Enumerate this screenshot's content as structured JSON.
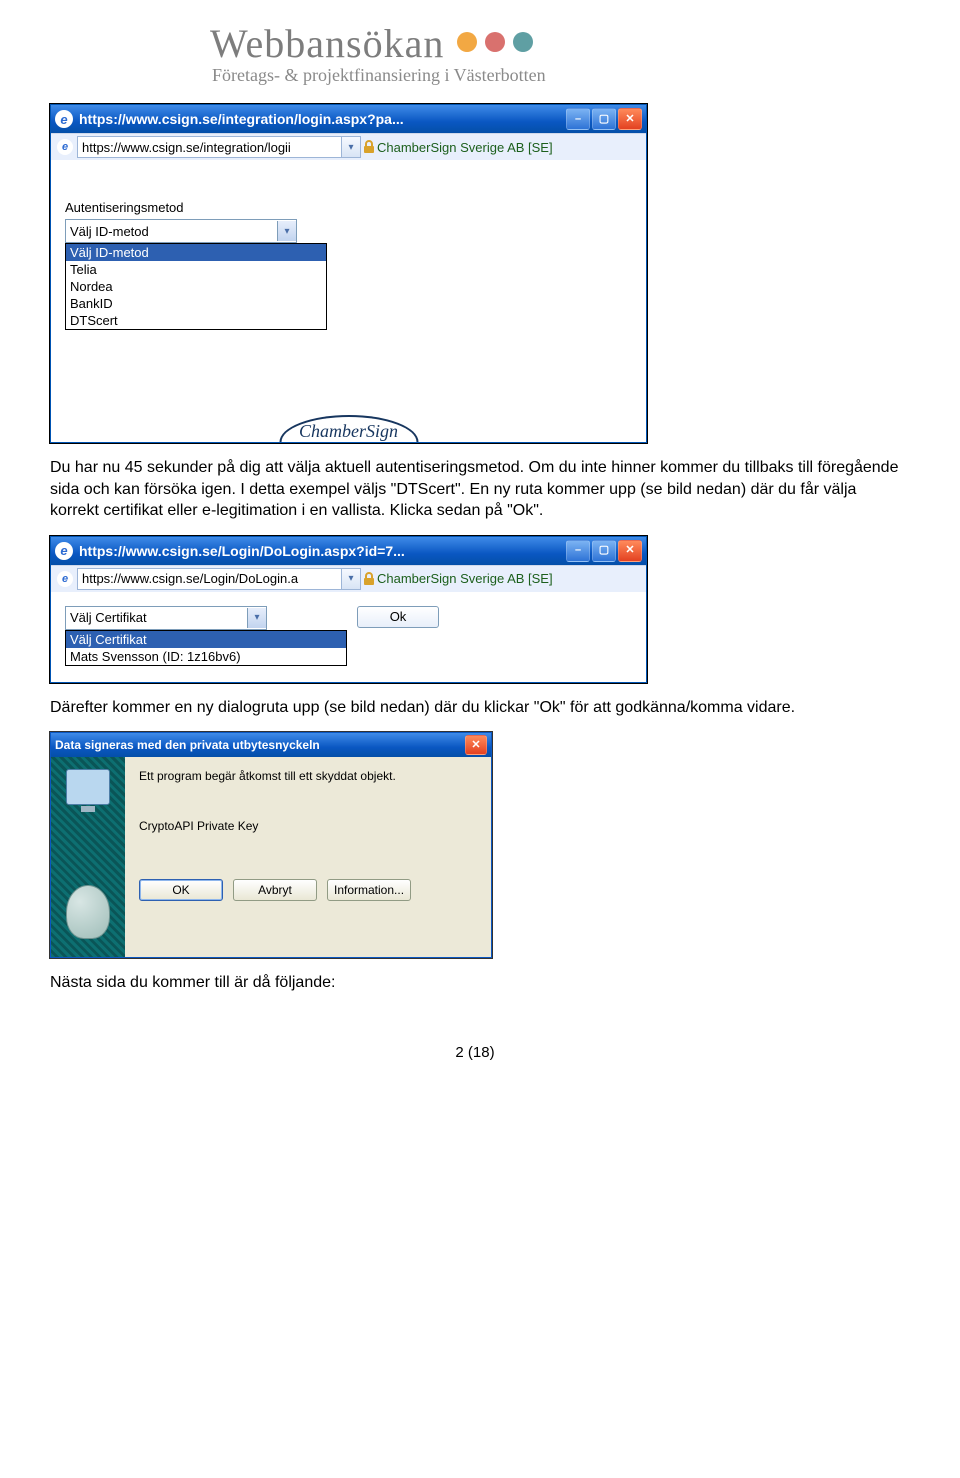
{
  "brand": {
    "title": "Webbansökan",
    "subtitle": "Företags- & projektfinansiering i Västerbotten",
    "dot_colors": [
      "#f2a843",
      "#d9716e",
      "#5f9fa3"
    ]
  },
  "screenshot1": {
    "title": "https://www.csign.se/integration/login.aspx?pa...",
    "address": "https://www.csign.se/integration/logii",
    "cert_owner": "ChamberSign Sverige AB [SE]",
    "label": "Autentiseringsmetod",
    "combo_value": "Välj ID-metod",
    "options": [
      "Välj ID-metod",
      "Telia",
      "Nordea",
      "BankID",
      "DTScert"
    ],
    "footer_logo": "ChamberSign"
  },
  "para1": "Du har nu 45 sekunder på dig att välja aktuell autentiseringsmetod. Om du inte hinner kommer du tillbaks till föregående sida och kan försöka igen. I detta exempel väljs \"DTScert\". En ny ruta kommer upp (se bild nedan) där du får välja korrekt certifikat eller e-legitimation i en vallista. Klicka sedan på \"Ok\".",
  "screenshot2": {
    "title": "https://www.csign.se/Login/DoLogin.aspx?id=7...",
    "address": "https://www.csign.se/Login/DoLogin.a",
    "cert_owner": "ChamberSign Sverige AB [SE]",
    "combo_value": "Välj Certifikat",
    "ok_label": "Ok",
    "options": [
      "Välj Certifikat",
      "Mats Svensson (ID: 1z16bv6)"
    ]
  },
  "para2": "Därefter kommer en ny dialogruta upp (se bild nedan) där du klickar \"Ok\" för att godkänna/komma vidare.",
  "dialog": {
    "title": "Data signeras med den privata utbytesnyckeln",
    "message": "Ett program begär åtkomst till ett skyddat objekt.",
    "key_label": "CryptoAPI Private Key",
    "buttons": [
      "OK",
      "Avbryt",
      "Information..."
    ]
  },
  "para3": "Nästa sida du kommer till är då följande:",
  "page_number": "2 (18)"
}
